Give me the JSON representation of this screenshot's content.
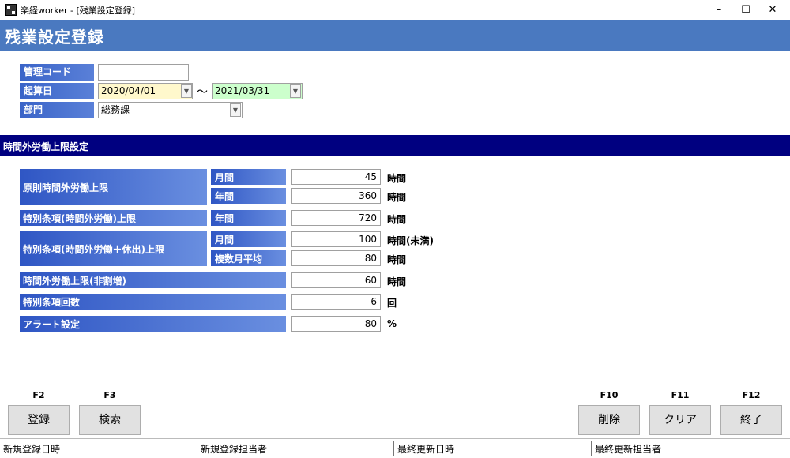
{
  "window": {
    "title": "楽経worker - [残業設定登録]",
    "minimize_glyph": "–",
    "maximize_glyph": "☐",
    "close_glyph": "✕"
  },
  "header": {
    "title": "残業設定登録"
  },
  "form": {
    "code": {
      "label": "管理コード",
      "value": ""
    },
    "period": {
      "label": "起算日",
      "from": "2020/04/01",
      "separator": "～",
      "to": "2021/03/31"
    },
    "department": {
      "label": "部門",
      "value": "総務課"
    }
  },
  "section": {
    "title": "時間外労働上限設定"
  },
  "limits": {
    "principle": {
      "label": "原則時間外労働上限",
      "monthly": {
        "label": "月間",
        "value": "45",
        "unit": "時間"
      },
      "yearly": {
        "label": "年間",
        "value": "360",
        "unit": "時間"
      }
    },
    "special_overtime": {
      "label": "特別条項(時間外労働)上限",
      "yearly": {
        "label": "年間",
        "value": "720",
        "unit": "時間"
      }
    },
    "special_total": {
      "label": "特別条項(時間外労働＋休出)上限",
      "monthly": {
        "label": "月間",
        "value": "100",
        "unit": "時間(未満)"
      },
      "multi_month": {
        "label": "複数月平均",
        "value": "80",
        "unit": "時間"
      }
    },
    "non_premium": {
      "label": "時間外労働上限(非割増)",
      "value": "60",
      "unit": "時間"
    },
    "special_count": {
      "label": "特別条項回数",
      "value": "6",
      "unit": "回"
    },
    "alert": {
      "label": "アラート設定",
      "value": "80",
      "unit": "%"
    }
  },
  "function_keys": {
    "f2": {
      "key": "F2",
      "label": "登録"
    },
    "f3": {
      "key": "F3",
      "label": "検索"
    },
    "f10": {
      "key": "F10",
      "label": "削除"
    },
    "f11": {
      "key": "F11",
      "label": "クリア"
    },
    "f12": {
      "key": "F12",
      "label": "終了"
    }
  },
  "status": {
    "created_at": "新規登録日時",
    "created_by": "新規登録担当者",
    "updated_at": "最終更新日時",
    "updated_by": "最終更新担当者"
  },
  "icons": {
    "dropdown": "chevron-down-icon",
    "app": "app-icon"
  }
}
